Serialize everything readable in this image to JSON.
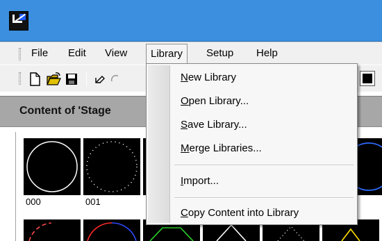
{
  "menubar": {
    "items": [
      {
        "label": "File"
      },
      {
        "label": "Edit"
      },
      {
        "label": "View"
      },
      {
        "label": "Library",
        "active": true
      },
      {
        "label": "Setup"
      },
      {
        "label": "Help"
      }
    ]
  },
  "toolbar": {
    "buttons": [
      "new-document-icon",
      "open-folder-icon",
      "save-disk-icon",
      "undo-icon",
      "redo-icon"
    ],
    "stop_button": "stop-icon"
  },
  "content": {
    "title": "Content of 'Stage"
  },
  "tiles": [
    {
      "label": "000",
      "shape": "circle-solid"
    },
    {
      "label": "001",
      "shape": "circle-dotted"
    }
  ],
  "library_menu": {
    "items": [
      {
        "label": "New Library",
        "accel": "N",
        "rest": "ew Library"
      },
      {
        "label": "Open Library...",
        "accel": "O",
        "rest": "pen Library..."
      },
      {
        "label": "Save Library...",
        "accel": "S",
        "rest": "ave Library..."
      },
      {
        "label": "Merge Libraries...",
        "accel": "M",
        "rest": "erge Libraries..."
      },
      {
        "label": "Import...",
        "accel": "I",
        "rest": "mport..."
      },
      {
        "label": "Copy Content into Library",
        "accel": "C",
        "rest": "opy Content into Library"
      }
    ]
  },
  "colors": {
    "titlebar": "#3c8fde",
    "header": "#a7a7a7",
    "menu_bg": "#f0f0f0"
  }
}
